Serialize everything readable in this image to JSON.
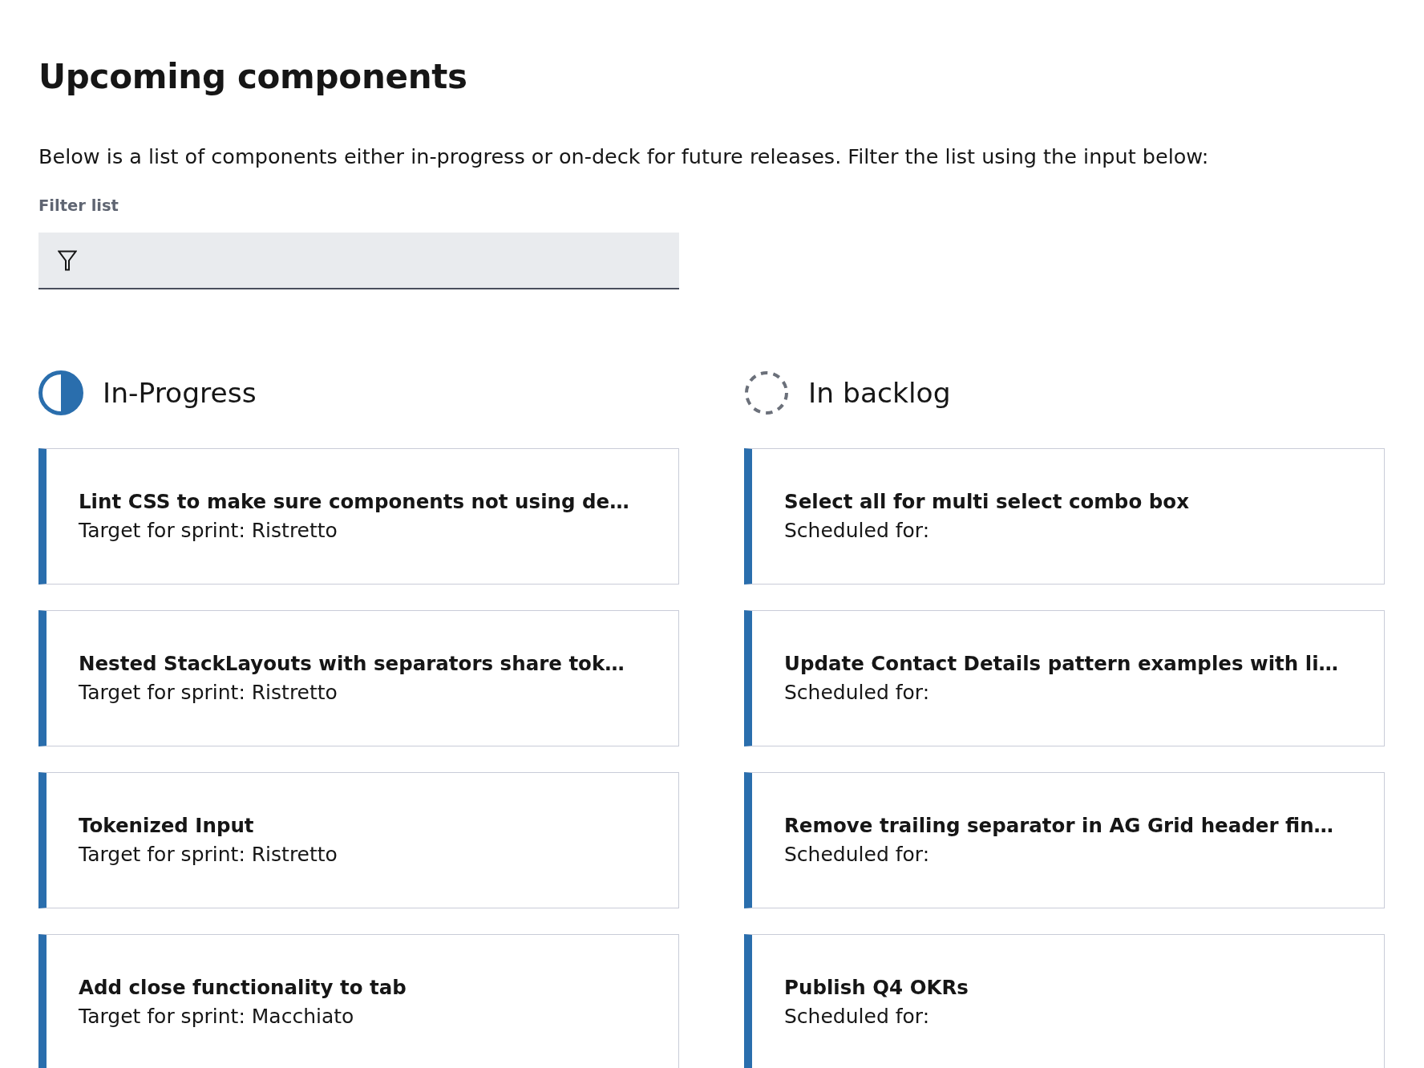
{
  "page": {
    "title": "Upcoming components",
    "description": "Below is a list of components either in-progress or on-deck for future releases. Filter the list using the input below:",
    "filter": {
      "label": "Filter list"
    }
  },
  "columns": [
    {
      "kind": "in_progress",
      "heading": "In-Progress",
      "items": [
        {
          "title": "Lint CSS to make sure components not using de…",
          "subtitle": "Target for sprint: Ristretto"
        },
        {
          "title": "Nested StackLayouts with separators share tok…",
          "subtitle": "Target for sprint: Ristretto"
        },
        {
          "title": "Tokenized Input",
          "subtitle": "Target for sprint: Ristretto"
        },
        {
          "title": "Add close functionality to tab",
          "subtitle": "Target for sprint: Macchiato"
        }
      ]
    },
    {
      "kind": "backlog",
      "heading": "In backlog",
      "items": [
        {
          "title": "Select all for multi select combo box",
          "subtitle": "Scheduled for:"
        },
        {
          "title": "Update Contact Details pattern examples with li…",
          "subtitle": "Scheduled for:"
        },
        {
          "title": "Remove trailing separator in AG Grid header fin…",
          "subtitle": "Scheduled for:"
        },
        {
          "title": "Publish Q4 OKRs",
          "subtitle": "Scheduled for:"
        }
      ]
    }
  ]
}
